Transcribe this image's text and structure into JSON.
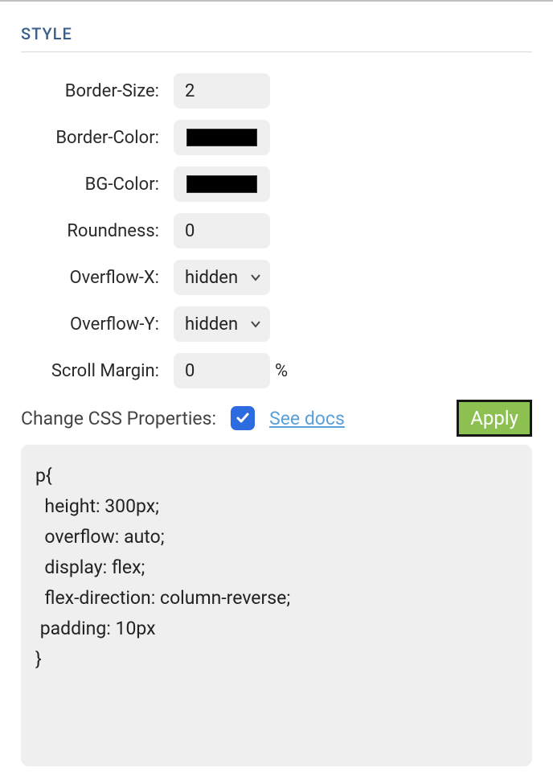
{
  "section_title": "STYLE",
  "fields": {
    "border_size": {
      "label": "Border-Size:",
      "value": "2"
    },
    "border_color": {
      "label": "Border-Color:",
      "value": "#000000"
    },
    "bg_color": {
      "label": "BG-Color:",
      "value": "#000000"
    },
    "roundness": {
      "label": "Roundness:",
      "value": "0"
    },
    "overflow_x": {
      "label": "Overflow-X:",
      "value": "hidden"
    },
    "overflow_y": {
      "label": "Overflow-Y:",
      "value": "hidden"
    },
    "scroll_margin": {
      "label": "Scroll Margin:",
      "value": "0",
      "unit": "%"
    }
  },
  "change_css": {
    "label": "Change CSS Properties:",
    "checked": true,
    "docs_link": "See docs",
    "apply_label": "Apply"
  },
  "css_code": "p{\n  height: 300px;\n  overflow: auto;\n  display: flex;\n  flex-direction: column-reverse;\n padding: 10px\n}"
}
